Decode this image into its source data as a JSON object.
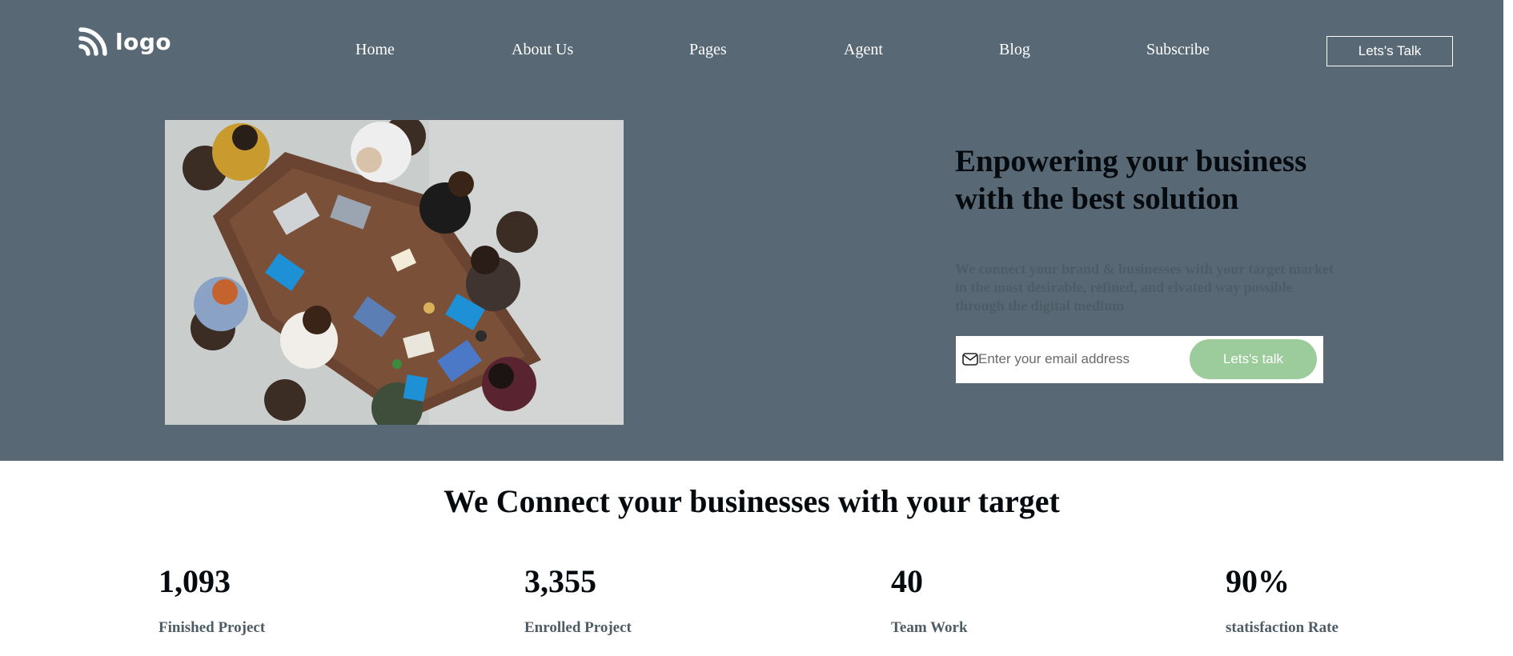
{
  "brand": {
    "logo_text": "logo",
    "logo_icon": "rss-feed-icon"
  },
  "nav": {
    "items": [
      {
        "label": "Home"
      },
      {
        "label": "About Us"
      },
      {
        "label": "Pages"
      },
      {
        "label": "Agent"
      },
      {
        "label": "Blog"
      },
      {
        "label": "Subscribe"
      }
    ],
    "cta_label": "Lets's Talk"
  },
  "hero": {
    "headline": "Enpowering your business with the best solution",
    "subtext": "We connect your brand & businesses with your target market in the most desirable, refined, and elvated way possible through the digital medium",
    "image_description_icon": "team-meeting-photo",
    "email": {
      "icon": "mail-icon",
      "placeholder": "Enter your email address",
      "value": "",
      "button_label": "Lets's talk"
    }
  },
  "stats_section": {
    "title": "We Connect your businesses with your target",
    "stats": [
      {
        "value": "1,093",
        "label": "Finished Project"
      },
      {
        "value": "3,355",
        "label": "Enrolled Project"
      },
      {
        "value": "40",
        "label": "Team Work"
      },
      {
        "value": "90%",
        "label": "statisfaction Rate"
      }
    ]
  },
  "colors": {
    "hero_background": "#586874",
    "cta_green": "#9ccc9c",
    "heading_text": "#050a0e",
    "muted_text": "#4e5c66"
  }
}
